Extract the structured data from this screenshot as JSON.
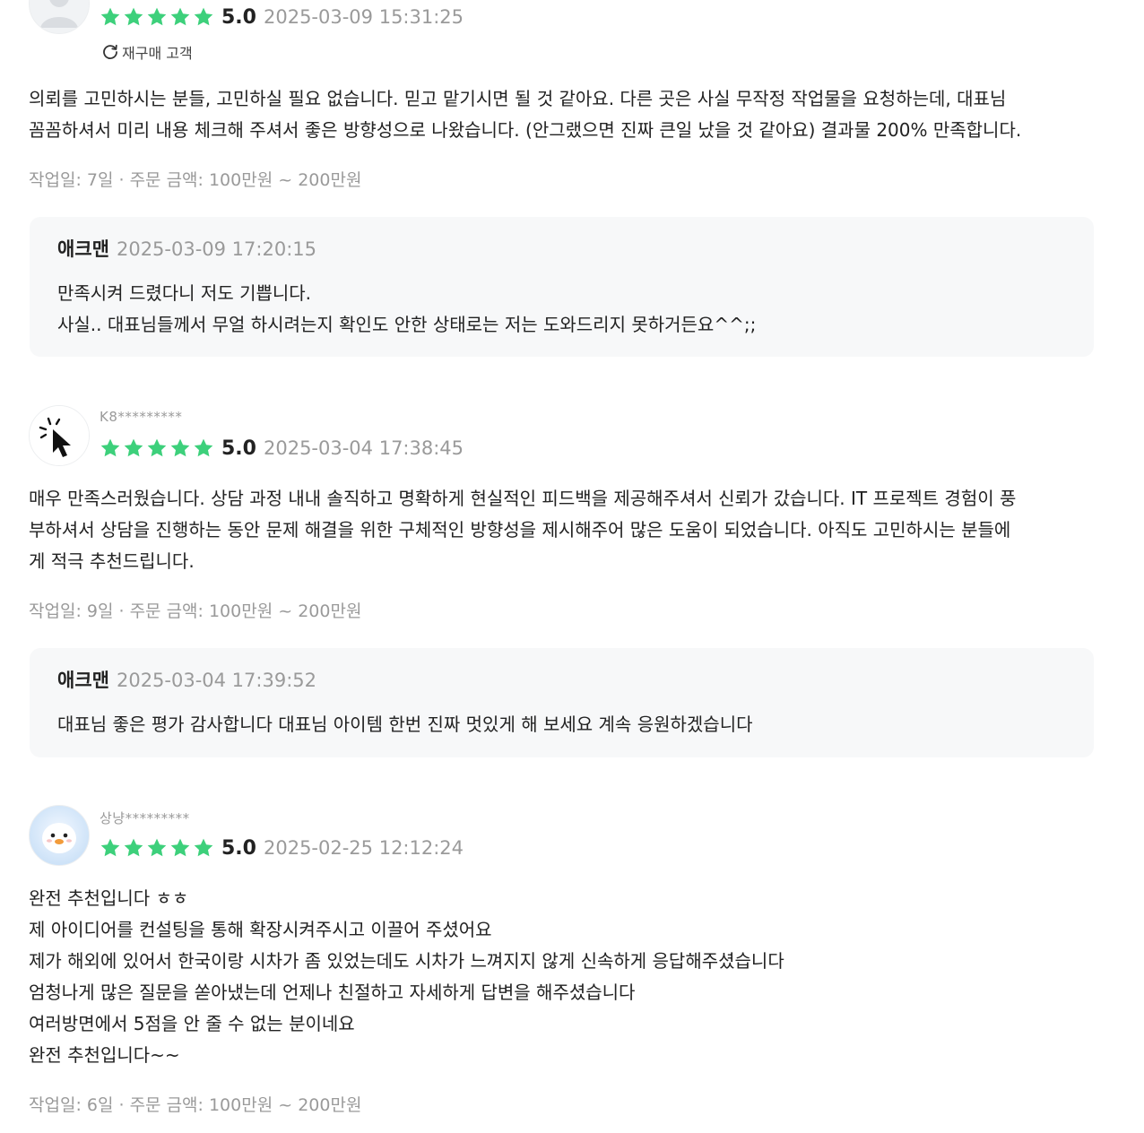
{
  "reviews": [
    {
      "username": "",
      "score": "5.0",
      "date": "2025-03-09 15:31:25",
      "badge": "재구매 고객",
      "lines": [
        "의뢰를 고민하시는 분들, 고민하실 필요 없습니다. 믿고 맡기시면 될 것 같아요. 다른 곳은 사실 무작정 작업물을 요청하는데, 대표님",
        "꼼꼼하셔서 미리 내용 체크해 주셔서 좋은 방향성으로 나왔습니다. (안그랬으면 진짜 큰일 났을 것 같아요) 결과물 200% 만족합니다."
      ],
      "meta": "작업일: 7일 · 주문 금액: 100만원 ~ 200만원",
      "reply": {
        "author": "애크맨",
        "date": "2025-03-09 17:20:15",
        "lines": [
          "만족시켜 드렸다니 저도 기쁩니다.",
          "사실.. 대표님들께서 무얼 하시려는지 확인도 안한 상태로는 저는 도와드리지 못하거든요^^;;"
        ]
      }
    },
    {
      "username": "K8*********",
      "score": "5.0",
      "date": "2025-03-04 17:38:45",
      "lines": [
        "매우 만족스러웠습니다. 상담 과정 내내 솔직하고 명확하게 현실적인 피드백을 제공해주셔서 신뢰가 갔습니다. IT 프로젝트 경험이 풍",
        "부하셔서 상담을 진행하는 동안 문제 해결을 위한 구체적인 방향성을 제시해주어 많은 도움이 되었습니다. 아직도 고민하시는 분들에",
        "게 적극 추천드립니다."
      ],
      "meta": "작업일: 9일 · 주문 금액: 100만원 ~ 200만원",
      "reply": {
        "author": "애크맨",
        "date": "2025-03-04 17:39:52",
        "lines": [
          "대표님 좋은 평가 감사합니다 대표님 아이템 한번 진짜 멋있게 해 보세요 계속 응원하겠습니다"
        ]
      }
    },
    {
      "username": "상냥*********",
      "score": "5.0",
      "date": "2025-02-25 12:12:24",
      "lines": [
        "완전 추천입니다 ㅎㅎ",
        "제 아이디어를 컨설팅을 통해 확장시켜주시고 이끌어 주셨어요",
        "제가 해외에 있어서 한국이랑 시차가 좀 있었는데도 시차가 느껴지지 않게 신속하게 응답해주셨습니다",
        "엄청나게 많은 질문을 쏟아냈는데 언제나 친절하고 자세하게 답변을 해주셨습니다",
        "여러방면에서 5점을 안 줄 수 없는 분이네요",
        "완전 추천입니다~~"
      ],
      "meta": "작업일: 6일 · 주문 금액: 100만원 ~ 200만원"
    }
  ],
  "colors": {
    "star": "#3dd07b",
    "muted": "#9a9a9a",
    "reply_bg": "#f7f8f9"
  },
  "icons": {
    "rating": "star-icon",
    "badge": "refresh-icon",
    "avatar_1": "default-user-avatar",
    "avatar_2": "cursor-click-avatar",
    "avatar_3": "duck-avatar"
  }
}
